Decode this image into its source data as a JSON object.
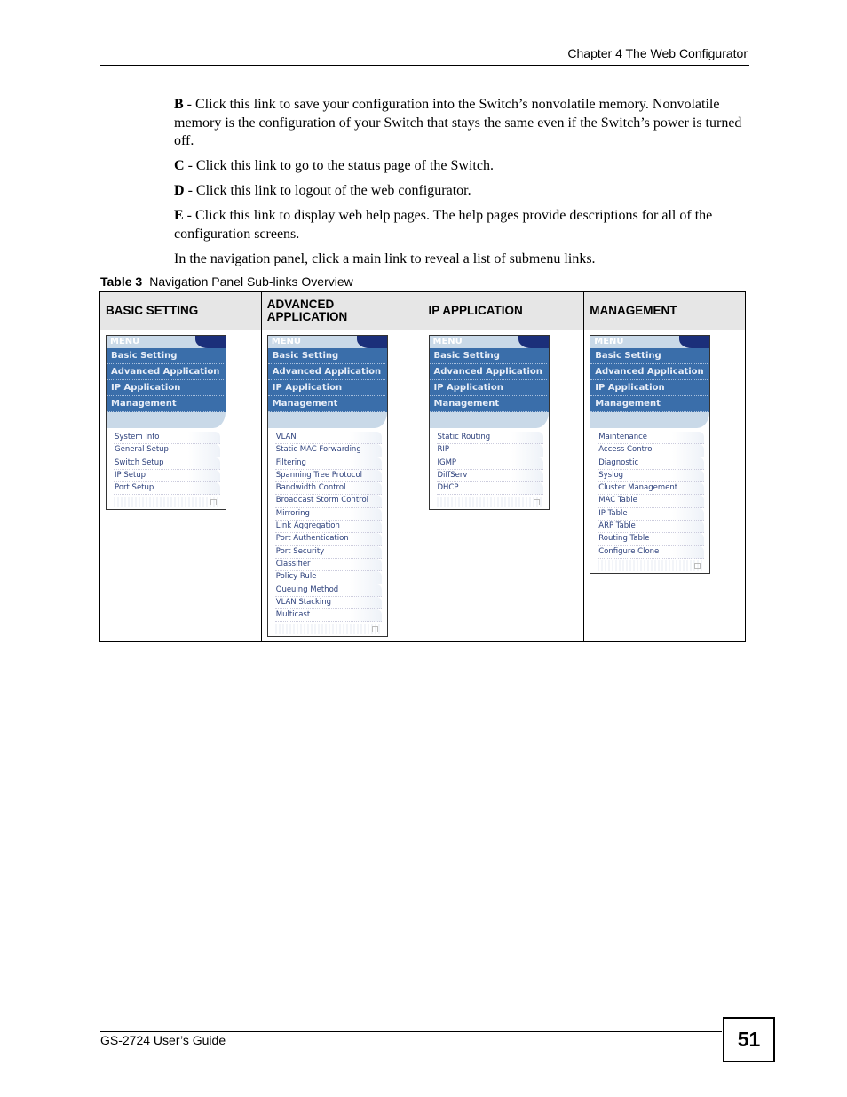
{
  "header": {
    "chapter": "Chapter 4 The Web Configurator"
  },
  "body": {
    "paragraphs": [
      {
        "label": "B",
        "text": " - Click this link to save your configuration into the Switch’s nonvolatile memory. Nonvolatile memory is the configuration of your Switch that stays the same even if the Switch’s power is turned off."
      },
      {
        "label": "C",
        "text": " - Click this link to go to the status page of the Switch."
      },
      {
        "label": "D",
        "text": " - Click this link to logout of the web configurator."
      },
      {
        "label": "E",
        "text": " - Click this link to display web help pages. The help pages provide descriptions for all of the configuration screens."
      },
      {
        "label": "",
        "text": "In the navigation panel, click a main link to reveal a list of submenu links."
      }
    ]
  },
  "table": {
    "caption_label": "Table 3",
    "caption_text": "Navigation Panel Sub-links Overview",
    "headers": [
      "BASIC SETTING",
      "ADVANCED APPLICATION",
      "IP APPLICATION",
      "MANAGEMENT"
    ],
    "menu": {
      "title": "MENU",
      "main_links": [
        "Basic Setting",
        "Advanced Application",
        "IP Application",
        "Management"
      ]
    },
    "columns": [
      {
        "sublinks": [
          "System Info",
          "General Setup",
          "Switch Setup",
          "IP Setup",
          "Port Setup"
        ]
      },
      {
        "sublinks": [
          "VLAN",
          "Static MAC Forwarding",
          "Filtering",
          "Spanning Tree Protocol",
          "Bandwidth Control",
          "Broadcast Storm Control",
          "Mirroring",
          "Link Aggregation",
          "Port Authentication",
          "Port Security",
          "Classifier",
          "Policy Rule",
          "Queuing Method",
          "VLAN Stacking",
          "Multicast"
        ]
      },
      {
        "sublinks": [
          "Static Routing",
          "RIP",
          "IGMP",
          "DiffServ",
          "DHCP"
        ]
      },
      {
        "sublinks": [
          "Maintenance",
          "Access Control",
          "Diagnostic",
          "Syslog",
          "Cluster Management",
          "MAC Table",
          "IP Table",
          "ARP Table",
          "Routing Table",
          "Configure Clone"
        ]
      }
    ]
  },
  "footer": {
    "guide": "GS-2724 User’s Guide",
    "page_number": "51"
  }
}
